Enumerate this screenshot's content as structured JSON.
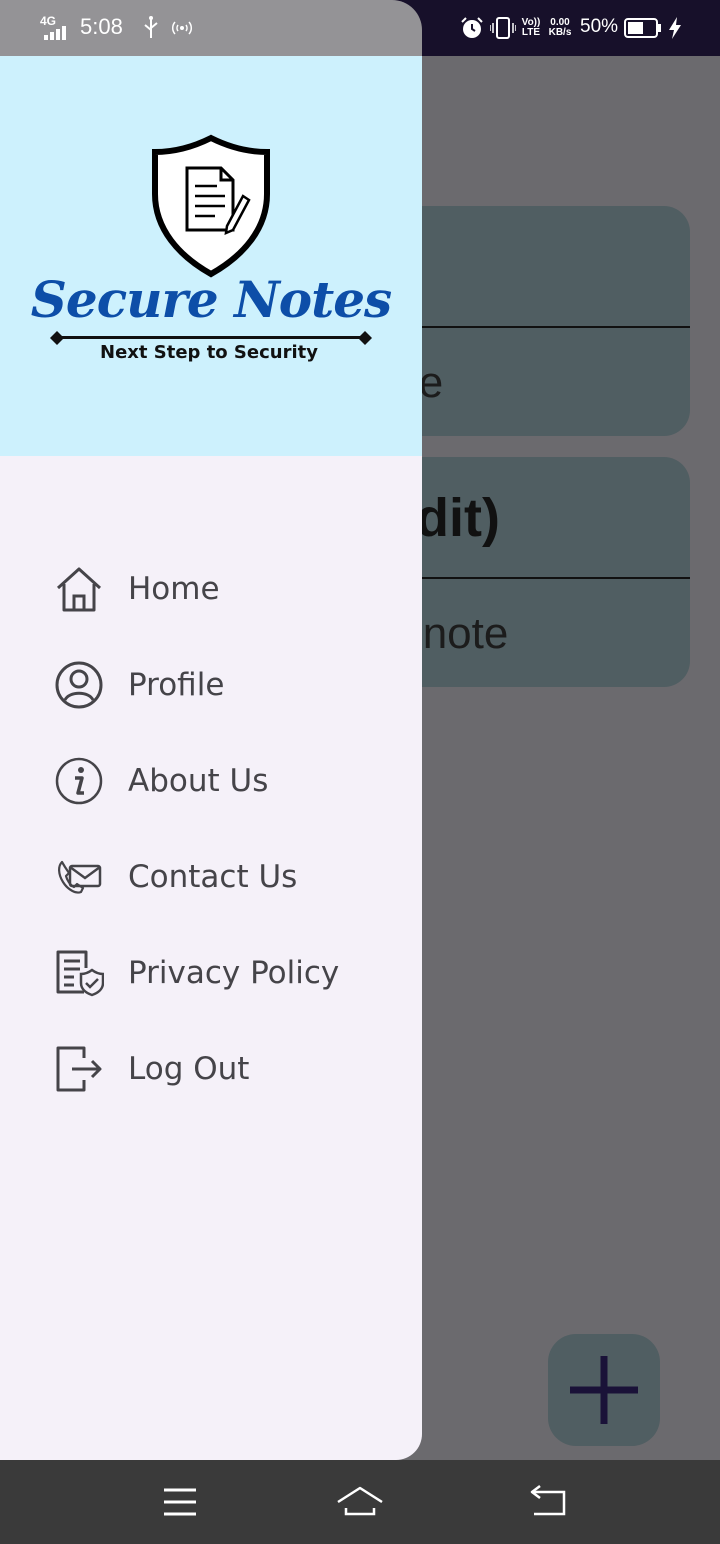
{
  "status_bar": {
    "time": "5:08",
    "network": "4G",
    "volte_top": "Vo))",
    "volte_bottom": "LTE",
    "speed_value": "0.00",
    "speed_unit": "KB/s",
    "battery_percent": "50%"
  },
  "background_notes": [
    {
      "title": "",
      "body": "ote"
    },
    {
      "title": "edit)",
      "body": "d note"
    }
  ],
  "drawer": {
    "logo": {
      "title": "Secure Notes",
      "tagline": "Next Step to Security",
      "icon": "shield-document-icon",
      "colors": {
        "title": "#0d4ea8",
        "header_bg": "#cdf1fd"
      }
    },
    "menu_items": [
      {
        "label": "Home",
        "icon": "home-icon"
      },
      {
        "label": "Profile",
        "icon": "profile-icon"
      },
      {
        "label": "About Us",
        "icon": "info-icon"
      },
      {
        "label": "Contact Us",
        "icon": "contact-icon"
      },
      {
        "label": "Privacy Policy",
        "icon": "privacy-policy-icon"
      },
      {
        "label": "Log Out",
        "icon": "logout-icon"
      }
    ]
  },
  "fab": {
    "icon": "plus-icon"
  },
  "nav_bar": {
    "buttons": [
      {
        "icon": "menu-icon"
      },
      {
        "icon": "home-nav-icon"
      },
      {
        "icon": "back-icon"
      }
    ]
  }
}
